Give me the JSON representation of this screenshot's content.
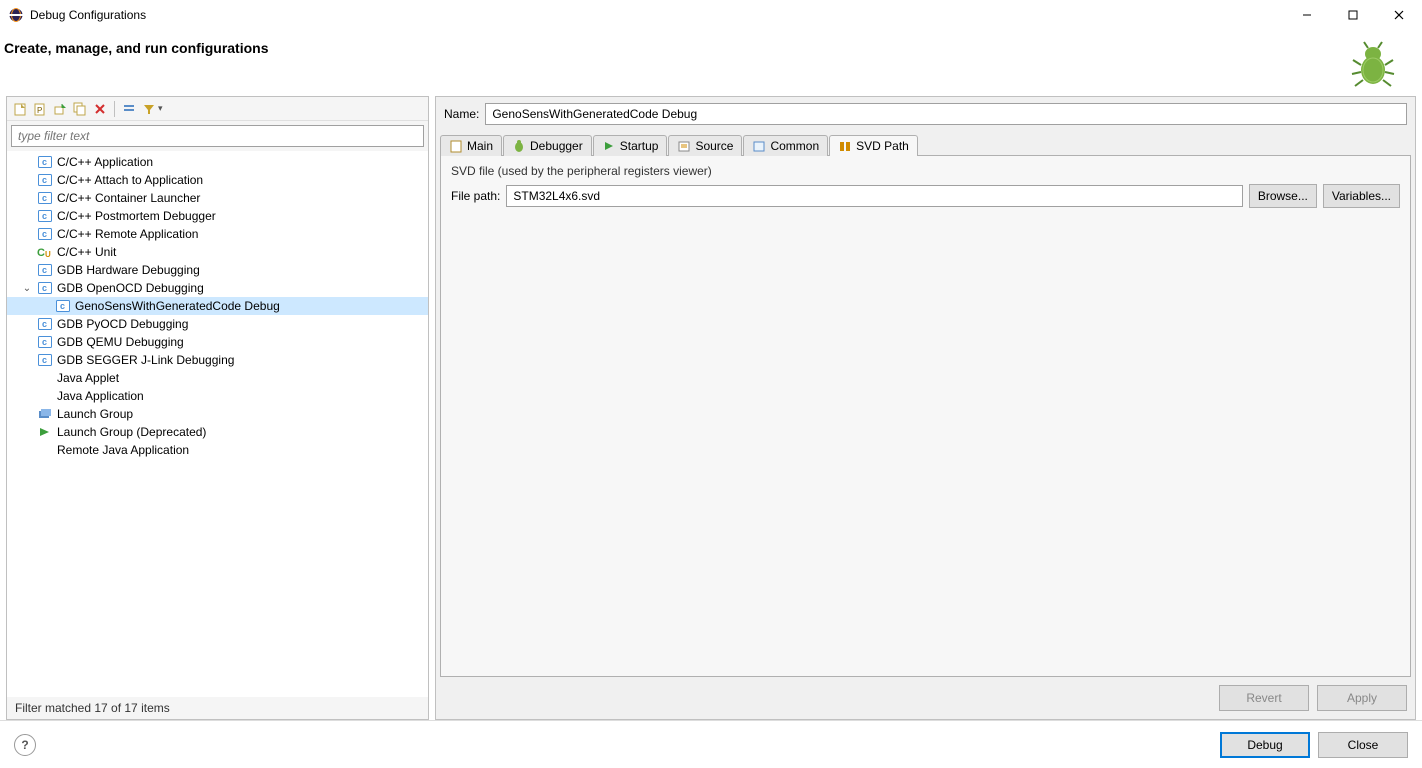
{
  "window": {
    "title": "Debug Configurations"
  },
  "header": {
    "heading": "Create, manage, and run configurations"
  },
  "filter": {
    "placeholder": "type filter text",
    "status": "Filter matched 17 of 17 items"
  },
  "tree": {
    "items": [
      {
        "label": "C/C++ Application",
        "icon": "c-app"
      },
      {
        "label": "C/C++ Attach to Application",
        "icon": "c-app"
      },
      {
        "label": "C/C++ Container Launcher",
        "icon": "c-app"
      },
      {
        "label": "C/C++ Postmortem Debugger",
        "icon": "c-app"
      },
      {
        "label": "C/C++ Remote Application",
        "icon": "c-app"
      },
      {
        "label": "C/C++ Unit",
        "icon": "c-unit"
      },
      {
        "label": "GDB Hardware Debugging",
        "icon": "c-app"
      },
      {
        "label": "GDB OpenOCD Debugging",
        "icon": "c-app",
        "expanded": true,
        "children": [
          {
            "label": "GenoSensWithGeneratedCode Debug",
            "icon": "c-app",
            "selected": true
          }
        ]
      },
      {
        "label": "GDB PyOCD Debugging",
        "icon": "c-app"
      },
      {
        "label": "GDB QEMU Debugging",
        "icon": "c-app"
      },
      {
        "label": "GDB SEGGER J-Link Debugging",
        "icon": "c-app"
      },
      {
        "label": "Java Applet",
        "icon": "none"
      },
      {
        "label": "Java Application",
        "icon": "none"
      },
      {
        "label": "Launch Group",
        "icon": "launch-group"
      },
      {
        "label": "Launch Group (Deprecated)",
        "icon": "launch-group-dep"
      },
      {
        "label": "Remote Java Application",
        "icon": "none"
      }
    ]
  },
  "config": {
    "name_label": "Name:",
    "name_value": "GenoSensWithGeneratedCode Debug"
  },
  "tabs": [
    {
      "id": "main",
      "label": "Main"
    },
    {
      "id": "debugger",
      "label": "Debugger"
    },
    {
      "id": "startup",
      "label": "Startup"
    },
    {
      "id": "source",
      "label": "Source"
    },
    {
      "id": "common",
      "label": "Common"
    },
    {
      "id": "svd",
      "label": "SVD Path",
      "active": true
    }
  ],
  "svd": {
    "group_label": "SVD file (used by the peripheral registers viewer)",
    "filepath_label": "File path:",
    "filepath_value": "STM32L4x6.svd",
    "browse_label": "Browse...",
    "variables_label": "Variables..."
  },
  "buttons": {
    "revert": "Revert",
    "apply": "Apply",
    "debug": "Debug",
    "close": "Close"
  }
}
